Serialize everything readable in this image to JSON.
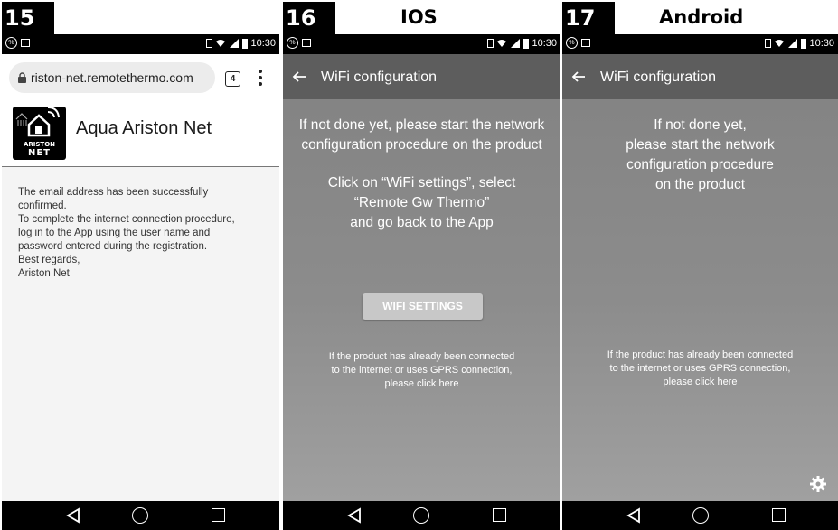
{
  "status_bar": {
    "time": "10:30"
  },
  "panels": {
    "p15": {
      "number": "15",
      "url": "riston-net.remotethermo.com",
      "tab_count": "4",
      "logo": {
        "line1": "ARISTON",
        "line2": "NET"
      },
      "site_title": "Aqua Ariston Net",
      "message": {
        "para1": [
          "The email address has been successfully",
          "confirmed."
        ],
        "para2": [
          "To complete the internet connection procedure,",
          "log in to the App using the user name and",
          "password entered during the registration."
        ],
        "para3": [
          "Best regards,",
          "Ariston Net"
        ]
      }
    },
    "p16": {
      "number": "16",
      "title": "IOS",
      "appbar_title": "WiFi configuration",
      "intro": [
        "If not done yet, please start the network",
        "configuration procedure on the product"
      ],
      "instructions": [
        "Click on “WiFi settings”, select",
        "“Remote Gw Thermo”",
        "and go back to the App"
      ],
      "button_label": "WIFI SETTINGS",
      "footer": [
        "If the product has already been connected",
        "to the internet or uses GPRS connection,",
        "please click here"
      ]
    },
    "p17": {
      "number": "17",
      "title": "Android",
      "appbar_title": "WiFi configuration",
      "intro": [
        "If not done yet,",
        "please start the network",
        "configuration procedure",
        "on the product"
      ],
      "footer": [
        "If the product has already been connected",
        "to the internet or uses GPRS connection,",
        "please click here"
      ]
    }
  }
}
